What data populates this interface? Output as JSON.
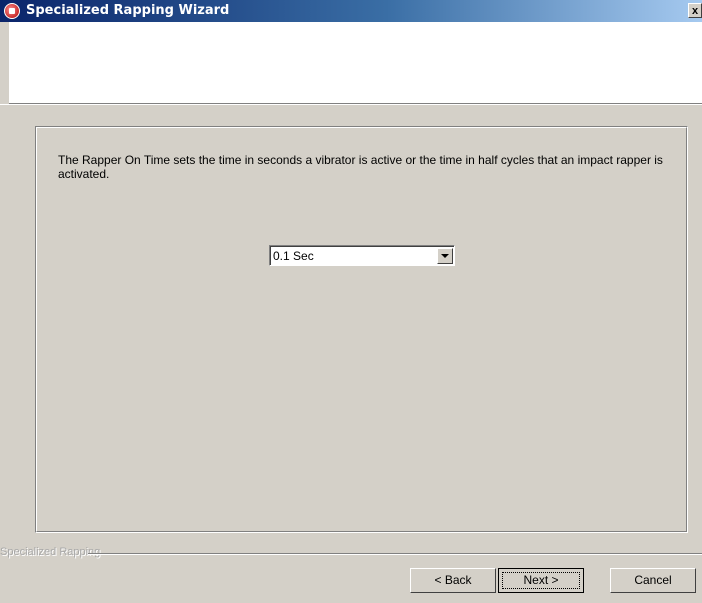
{
  "window": {
    "title": "Specialized Rapping Wizard",
    "close_label": "x"
  },
  "content": {
    "description": "The Rapper On Time sets the time in seconds a vibrator is active or the time in half cycles that an impact rapper is activated.",
    "rapper_on_time": {
      "selected": "0.1 Sec"
    }
  },
  "footer": {
    "group_label": "Specialized Rapping",
    "back_label": "< Back",
    "next_label": "Next >",
    "cancel_label": "Cancel"
  }
}
